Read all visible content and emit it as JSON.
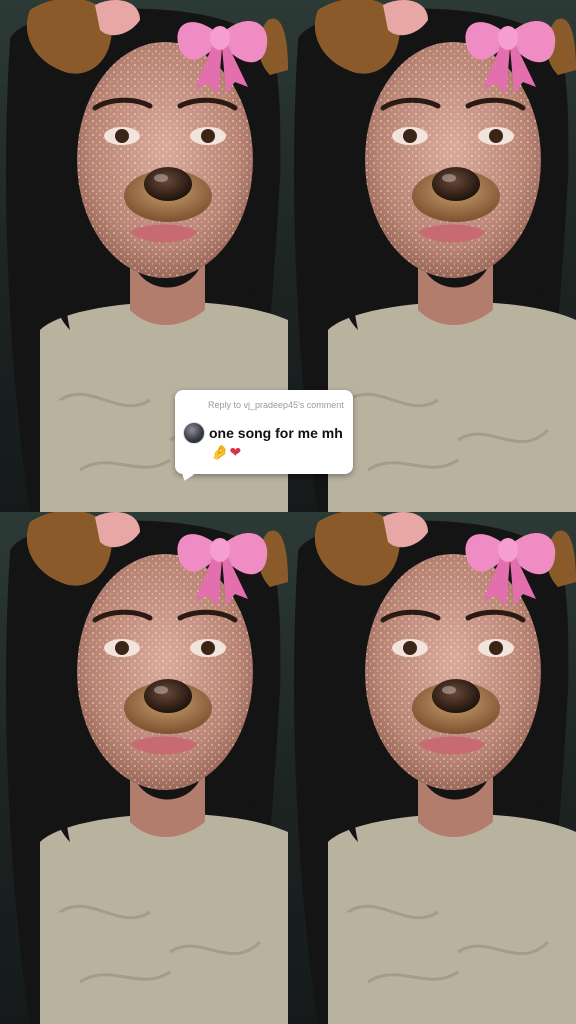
{
  "tiles": [
    {
      "label": "filter-tile-top-left"
    },
    {
      "label": "filter-tile-top-right"
    },
    {
      "label": "filter-tile-bottom-left"
    },
    {
      "label": "filter-tile-bottom-right"
    }
  ],
  "reply": {
    "header": "Reply to vj_pradeep45's comment",
    "comment": "one song for me mh",
    "emoji_hand": "🤌",
    "emoji_heart": "❤"
  },
  "colors": {
    "bow": "#f08cc4",
    "ears": "#8a5a2b",
    "shirt": "#b9b29f",
    "hair": "#141414",
    "card": "#ffffff"
  }
}
